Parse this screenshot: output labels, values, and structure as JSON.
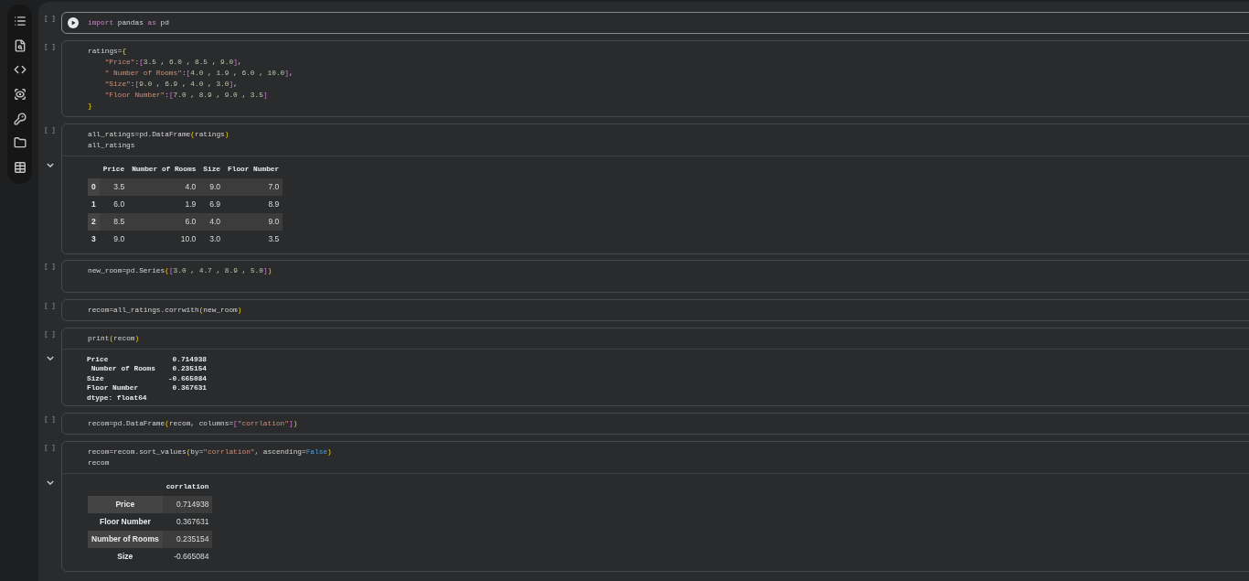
{
  "cells": [
    {
      "selected": true,
      "exec_count": "[ ]",
      "code": [
        {
          "tokens": [
            {
              "kind": "keyword",
              "text": "import"
            },
            {
              "kind": "plain",
              "text": " pandas "
            },
            {
              "kind": "keyword",
              "text": "as"
            },
            {
              "kind": "plain",
              "text": " pd"
            }
          ]
        }
      ]
    },
    {
      "selected": false,
      "exec_count": "[ ]",
      "code": [
        {
          "tokens": [
            {
              "kind": "plain",
              "text": "ratings="
            },
            {
              "kind": "bracket",
              "text": "{"
            }
          ],
          "children": [
            {
              "tokens": [
                {
                  "kind": "string",
                  "text": "\"Price\""
                },
                {
                  "kind": "plain",
                  "text": ":"
                },
                {
                  "kind": "bracket2",
                  "text": "["
                },
                {
                  "kind": "number",
                  "text": "3.5"
                },
                {
                  "kind": "plain",
                  "text": " , "
                },
                {
                  "kind": "number",
                  "text": "6.0"
                },
                {
                  "kind": "plain",
                  "text": " , "
                },
                {
                  "kind": "number",
                  "text": "8.5"
                },
                {
                  "kind": "plain",
                  "text": " , "
                },
                {
                  "kind": "number",
                  "text": "9.0"
                },
                {
                  "kind": "bracket2",
                  "text": "]"
                },
                {
                  "kind": "plain",
                  "text": ","
                }
              ]
            },
            {
              "tokens": [
                {
                  "kind": "string",
                  "text": "\" Number of Rooms\""
                },
                {
                  "kind": "plain",
                  "text": ":"
                },
                {
                  "kind": "bracket2",
                  "text": "["
                },
                {
                  "kind": "number",
                  "text": "4.0"
                },
                {
                  "kind": "plain",
                  "text": " , "
                },
                {
                  "kind": "number",
                  "text": "1.9"
                },
                {
                  "kind": "plain",
                  "text": " , "
                },
                {
                  "kind": "number",
                  "text": "6.0"
                },
                {
                  "kind": "plain",
                  "text": " , "
                },
                {
                  "kind": "number",
                  "text": "10.0"
                },
                {
                  "kind": "bracket2",
                  "text": "]"
                },
                {
                  "kind": "plain",
                  "text": ","
                }
              ]
            },
            {
              "tokens": [
                {
                  "kind": "string",
                  "text": "\"Size\""
                },
                {
                  "kind": "plain",
                  "text": ":"
                },
                {
                  "kind": "bracket2",
                  "text": "["
                },
                {
                  "kind": "number",
                  "text": "9.0"
                },
                {
                  "kind": "plain",
                  "text": " , "
                },
                {
                  "kind": "number",
                  "text": "6.9"
                },
                {
                  "kind": "plain",
                  "text": " , "
                },
                {
                  "kind": "number",
                  "text": "4.0"
                },
                {
                  "kind": "plain",
                  "text": " , "
                },
                {
                  "kind": "number",
                  "text": "3.0"
                },
                {
                  "kind": "bracket2",
                  "text": "]"
                },
                {
                  "kind": "plain",
                  "text": ","
                }
              ]
            },
            {
              "tokens": [
                {
                  "kind": "string",
                  "text": "\"Floor Number\""
                },
                {
                  "kind": "plain",
                  "text": ":"
                },
                {
                  "kind": "bracket2",
                  "text": "["
                },
                {
                  "kind": "number",
                  "text": "7.0"
                },
                {
                  "kind": "plain",
                  "text": " , "
                },
                {
                  "kind": "number",
                  "text": "8.9"
                },
                {
                  "kind": "plain",
                  "text": " , "
                },
                {
                  "kind": "number",
                  "text": "9.0"
                },
                {
                  "kind": "plain",
                  "text": " , "
                },
                {
                  "kind": "number",
                  "text": "3.5"
                },
                {
                  "kind": "bracket2",
                  "text": "]"
                }
              ]
            }
          ]
        },
        {
          "tokens": [
            {
              "kind": "bracket",
              "text": "}"
            }
          ]
        }
      ]
    },
    {
      "selected": false,
      "exec_count": "[ ]",
      "code": [
        {
          "tokens": [
            {
              "kind": "plain",
              "text": "all_ratings=pd.DataFrame"
            },
            {
              "kind": "bracket",
              "text": "("
            },
            {
              "kind": "plain",
              "text": "ratings"
            },
            {
              "kind": "bracket",
              "text": ")"
            }
          ]
        },
        {
          "tokens": [
            {
              "kind": "plain",
              "text": "all_ratings"
            }
          ]
        }
      ],
      "output": {
        "kind": "table",
        "expanded": true,
        "columns": [
          "Price",
          "Number of Rooms",
          "Size",
          "Floor Number"
        ],
        "rows": [
          {
            "index": "0",
            "values": [
              "3.5",
              "4.0",
              "9.0",
              "7.0"
            ]
          },
          {
            "index": "1",
            "values": [
              "6.0",
              "1.9",
              "6.9",
              "8.9"
            ]
          },
          {
            "index": "2",
            "values": [
              "8.5",
              "6.0",
              "4.0",
              "9.0"
            ]
          },
          {
            "index": "3",
            "values": [
              "9.0",
              "10.0",
              "3.0",
              "3.5"
            ]
          }
        ]
      }
    },
    {
      "selected": false,
      "exec_count": "[ ]",
      "code": [
        {
          "tokens": [
            {
              "kind": "plain",
              "text": "new_room=pd.Series"
            },
            {
              "kind": "bracket",
              "text": "("
            },
            {
              "kind": "bracket2",
              "text": "["
            },
            {
              "kind": "number",
              "text": "3.0"
            },
            {
              "kind": "plain",
              "text": " , "
            },
            {
              "kind": "number",
              "text": "4.7"
            },
            {
              "kind": "plain",
              "text": " , "
            },
            {
              "kind": "number",
              "text": "8.9"
            },
            {
              "kind": "plain",
              "text": " , "
            },
            {
              "kind": "number",
              "text": "5.0"
            },
            {
              "kind": "bracket2",
              "text": "]"
            },
            {
              "kind": "bracket",
              "text": ")"
            }
          ]
        }
      ]
    },
    {
      "selected": false,
      "exec_count": "[ ]",
      "code": [
        {
          "tokens": [
            {
              "kind": "plain",
              "text": "recom=all_ratings.corrwith"
            },
            {
              "kind": "bracket",
              "text": "("
            },
            {
              "kind": "plain",
              "text": "new_room"
            },
            {
              "kind": "bracket",
              "text": ")"
            }
          ]
        }
      ]
    },
    {
      "selected": false,
      "exec_count": "[ ]",
      "code": [
        {
          "tokens": [
            {
              "kind": "plain",
              "text": "print"
            },
            {
              "kind": "bracket",
              "text": "("
            },
            {
              "kind": "plain",
              "text": "recom"
            },
            {
              "kind": "bracket",
              "text": ")"
            }
          ]
        }
      ],
      "output": {
        "kind": "text",
        "expanded": true,
        "lines": [
          "Price               0.714938",
          " Number of Rooms    0.235154",
          "Size               -0.665084",
          "Floor Number        0.367631",
          "dtype: float64"
        ]
      }
    },
    {
      "selected": false,
      "exec_count": "[ ]",
      "code": [
        {
          "tokens": [
            {
              "kind": "plain",
              "text": "recom=pd.DataFrame"
            },
            {
              "kind": "bracket",
              "text": "("
            },
            {
              "kind": "plain",
              "text": "recom, columns="
            },
            {
              "kind": "bracket2",
              "text": "["
            },
            {
              "kind": "string",
              "text": "\"corrlation\""
            },
            {
              "kind": "bracket2",
              "text": "]"
            },
            {
              "kind": "bracket",
              "text": ")"
            }
          ]
        }
      ]
    },
    {
      "selected": false,
      "exec_count": "[ ]",
      "code": [
        {
          "tokens": [
            {
              "kind": "plain",
              "text": "recom=recom.sort_values"
            },
            {
              "kind": "bracket",
              "text": "("
            },
            {
              "kind": "plain",
              "text": "by="
            },
            {
              "kind": "string",
              "text": "\"corrlation\""
            },
            {
              "kind": "plain",
              "text": ", ascending="
            },
            {
              "kind": "constant",
              "text": "False"
            },
            {
              "kind": "bracket",
              "text": ")"
            }
          ]
        },
        {
          "tokens": [
            {
              "kind": "plain",
              "text": "recom"
            }
          ]
        }
      ],
      "output": {
        "kind": "table",
        "expanded": true,
        "columns": [
          "corrlation"
        ],
        "rows": [
          {
            "index": "Price",
            "values": [
              "0.714938"
            ]
          },
          {
            "index": "Floor Number",
            "values": [
              "0.367631"
            ]
          },
          {
            "index": "Number of Rooms",
            "values": [
              "0.235154"
            ]
          },
          {
            "index": "Size",
            "values": [
              "-0.665084"
            ]
          }
        ]
      }
    }
  ]
}
